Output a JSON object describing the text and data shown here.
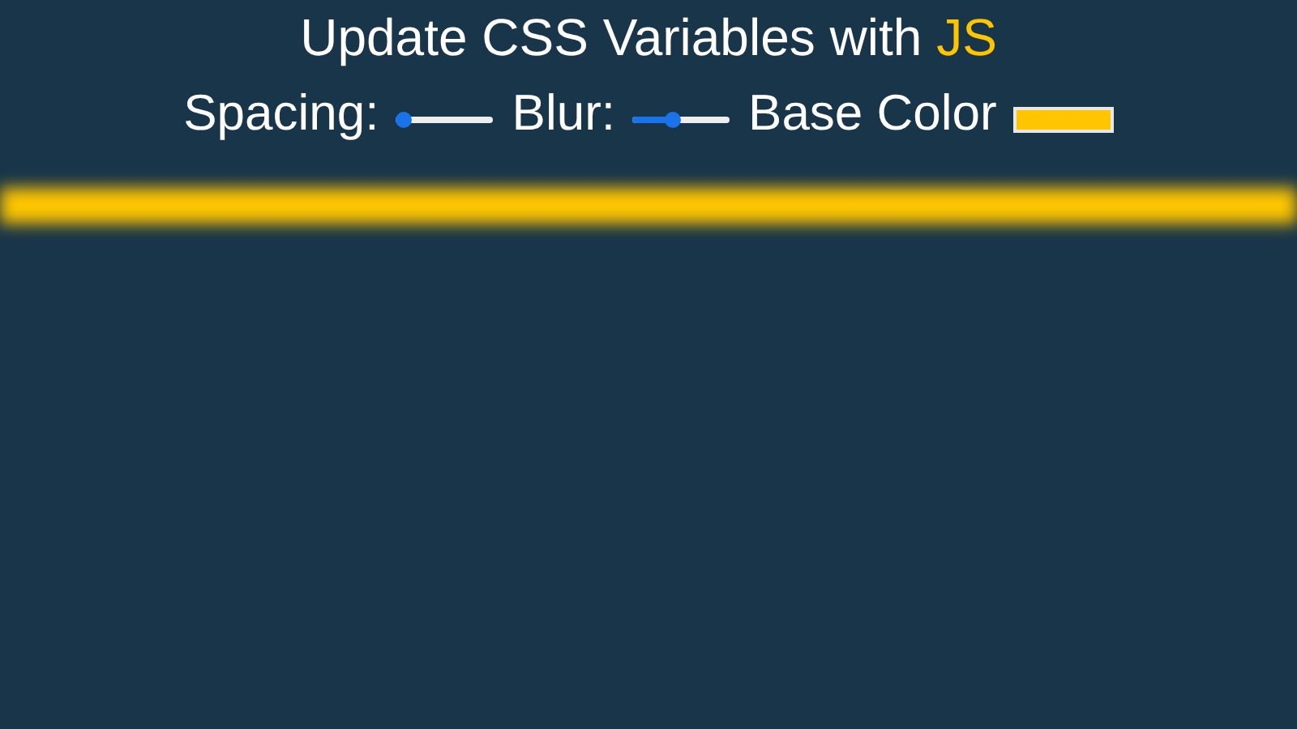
{
  "title": {
    "text": "Update CSS Variables with ",
    "highlight": "JS"
  },
  "controls": [
    {
      "kind": "slider",
      "label": "Spacing:",
      "level": 0.0
    },
    {
      "kind": "slider",
      "label": "Blur:",
      "level": 0.4
    },
    {
      "kind": "color",
      "label": "Base Color",
      "color": "#ffc600"
    }
  ]
}
